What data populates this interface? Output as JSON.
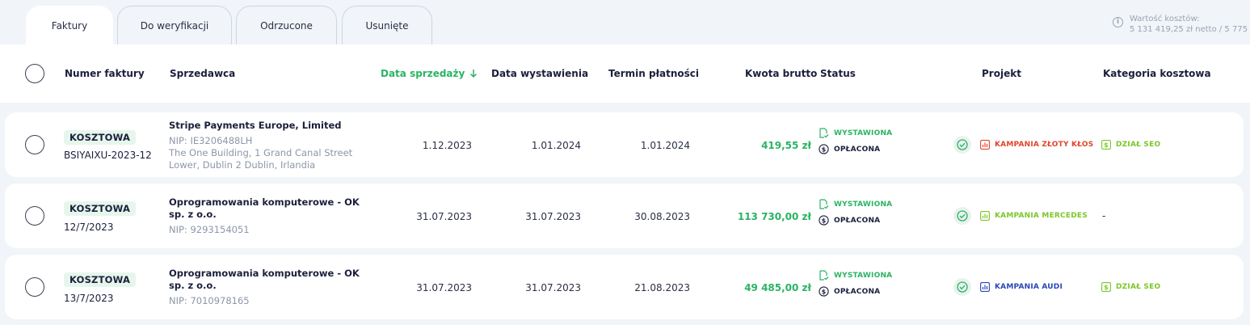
{
  "tabs": [
    {
      "label": "Faktury",
      "active": true
    },
    {
      "label": "Do weryfikacji",
      "active": false
    },
    {
      "label": "Odrzucone",
      "active": false
    },
    {
      "label": "Usunięte",
      "active": false
    }
  ],
  "summary": {
    "label": "Wartość kosztów:",
    "value": "5 131 419,25 zł netto / 5 775"
  },
  "columns": {
    "invoice_number": "Numer faktury",
    "seller": "Sprzedawca",
    "sale_date": "Data sprzedaży",
    "issue_date": "Data wystawienia",
    "due_date": "Termin płatności",
    "gross_amount": "Kwota brutto",
    "status": "Status",
    "project": "Projekt",
    "cost_category": "Kategoria kosztowa"
  },
  "colors": {
    "accent_green": "#29b463",
    "project_red": "#e0452b",
    "project_lime": "#7cc62a",
    "project_blue": "#2b46b8",
    "category_lime": "#7cc62a"
  },
  "rows": [
    {
      "type_badge": "KOSZTOWA",
      "invoice_number": "BSIYAIXU-2023-12",
      "seller_name": "Stripe Payments Europe, Limited",
      "nip": "NIP: IE3206488LH",
      "address_1": "The One Building, 1 Grand Canal Street",
      "address_2": "Lower, Dublin 2 Dublin, Irlandia",
      "sale_date": "1.12.2023",
      "issue_date": "1.01.2024",
      "due_date": "1.01.2024",
      "gross_amount": "419,55 zł",
      "status_issued": "WYSTAWIONA",
      "status_paid": "OPŁACONA",
      "project": "KAMPANIA ZŁOTY KŁOS",
      "category": "DZIAŁ SEO"
    },
    {
      "type_badge": "KOSZTOWA",
      "invoice_number": "12/7/2023",
      "seller_name": "Oprogramowania komputerowe - OK sp. z o.o.",
      "nip": "NIP: 9293154051",
      "sale_date": "31.07.2023",
      "issue_date": "31.07.2023",
      "due_date": "30.08.2023",
      "gross_amount": "113 730,00 zł",
      "status_issued": "WYSTAWIONA",
      "status_paid": "OPŁACONA",
      "project": "KAMPANIA MERCEDES",
      "category": "-"
    },
    {
      "type_badge": "KOSZTOWA",
      "invoice_number": "13/7/2023",
      "seller_name": "Oprogramowania komputerowe - OK sp. z o.o.",
      "nip": "NIP: 7010978165",
      "sale_date": "31.07.2023",
      "issue_date": "31.07.2023",
      "due_date": "21.08.2023",
      "gross_amount": "49 485,00 zł",
      "status_issued": "WYSTAWIONA",
      "status_paid": "OPŁACONA",
      "project": "KAMPANIA AUDI",
      "category": "DZIAŁ SEO"
    }
  ]
}
